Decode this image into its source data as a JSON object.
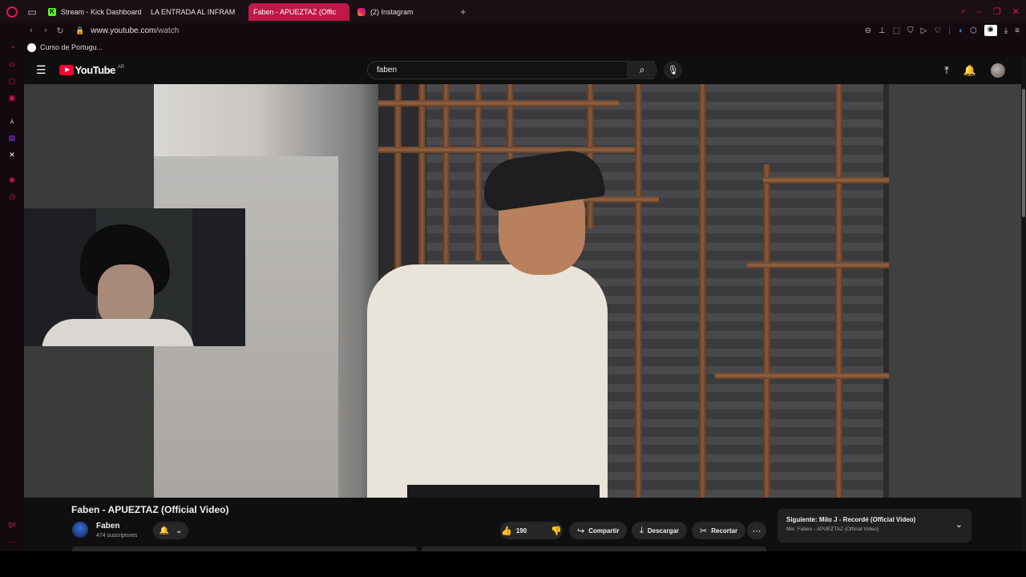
{
  "browser": {
    "tabs": [
      {
        "label": "Stream - Kick Dashboard",
        "favicon": "kick-icon",
        "active": false
      },
      {
        "label": "LA ENTRADA AL INFRAM",
        "favicon": "youtube-icon",
        "active": false
      },
      {
        "label": "Faben - APUEZTAZ (Offic",
        "favicon": "youtube-icon",
        "active": true
      },
      {
        "label": "(2) Instagram",
        "favicon": "instagram-icon",
        "active": false
      }
    ],
    "url_host": "www.youtube.com",
    "url_path": "/watch",
    "bookmark": "Curso de Portugu...",
    "accent": "#e0174a"
  },
  "youtube": {
    "logo_text": "YouTube",
    "region": "AR",
    "search_value": "faben"
  },
  "video": {
    "title": "Faben - APUEZTAZ (Official Video)",
    "channel_name": "Faben",
    "subscribers": "474 suscriptores",
    "likes": "190",
    "share_label": "Compartir",
    "download_label": "Descargar",
    "clip_label": "Recortar"
  },
  "next_up": {
    "title": "Siguiente: Milo J - Recordé (Official Video)",
    "subtitle": "Mix: Faben - APUEZTAZ (Official Video)"
  }
}
